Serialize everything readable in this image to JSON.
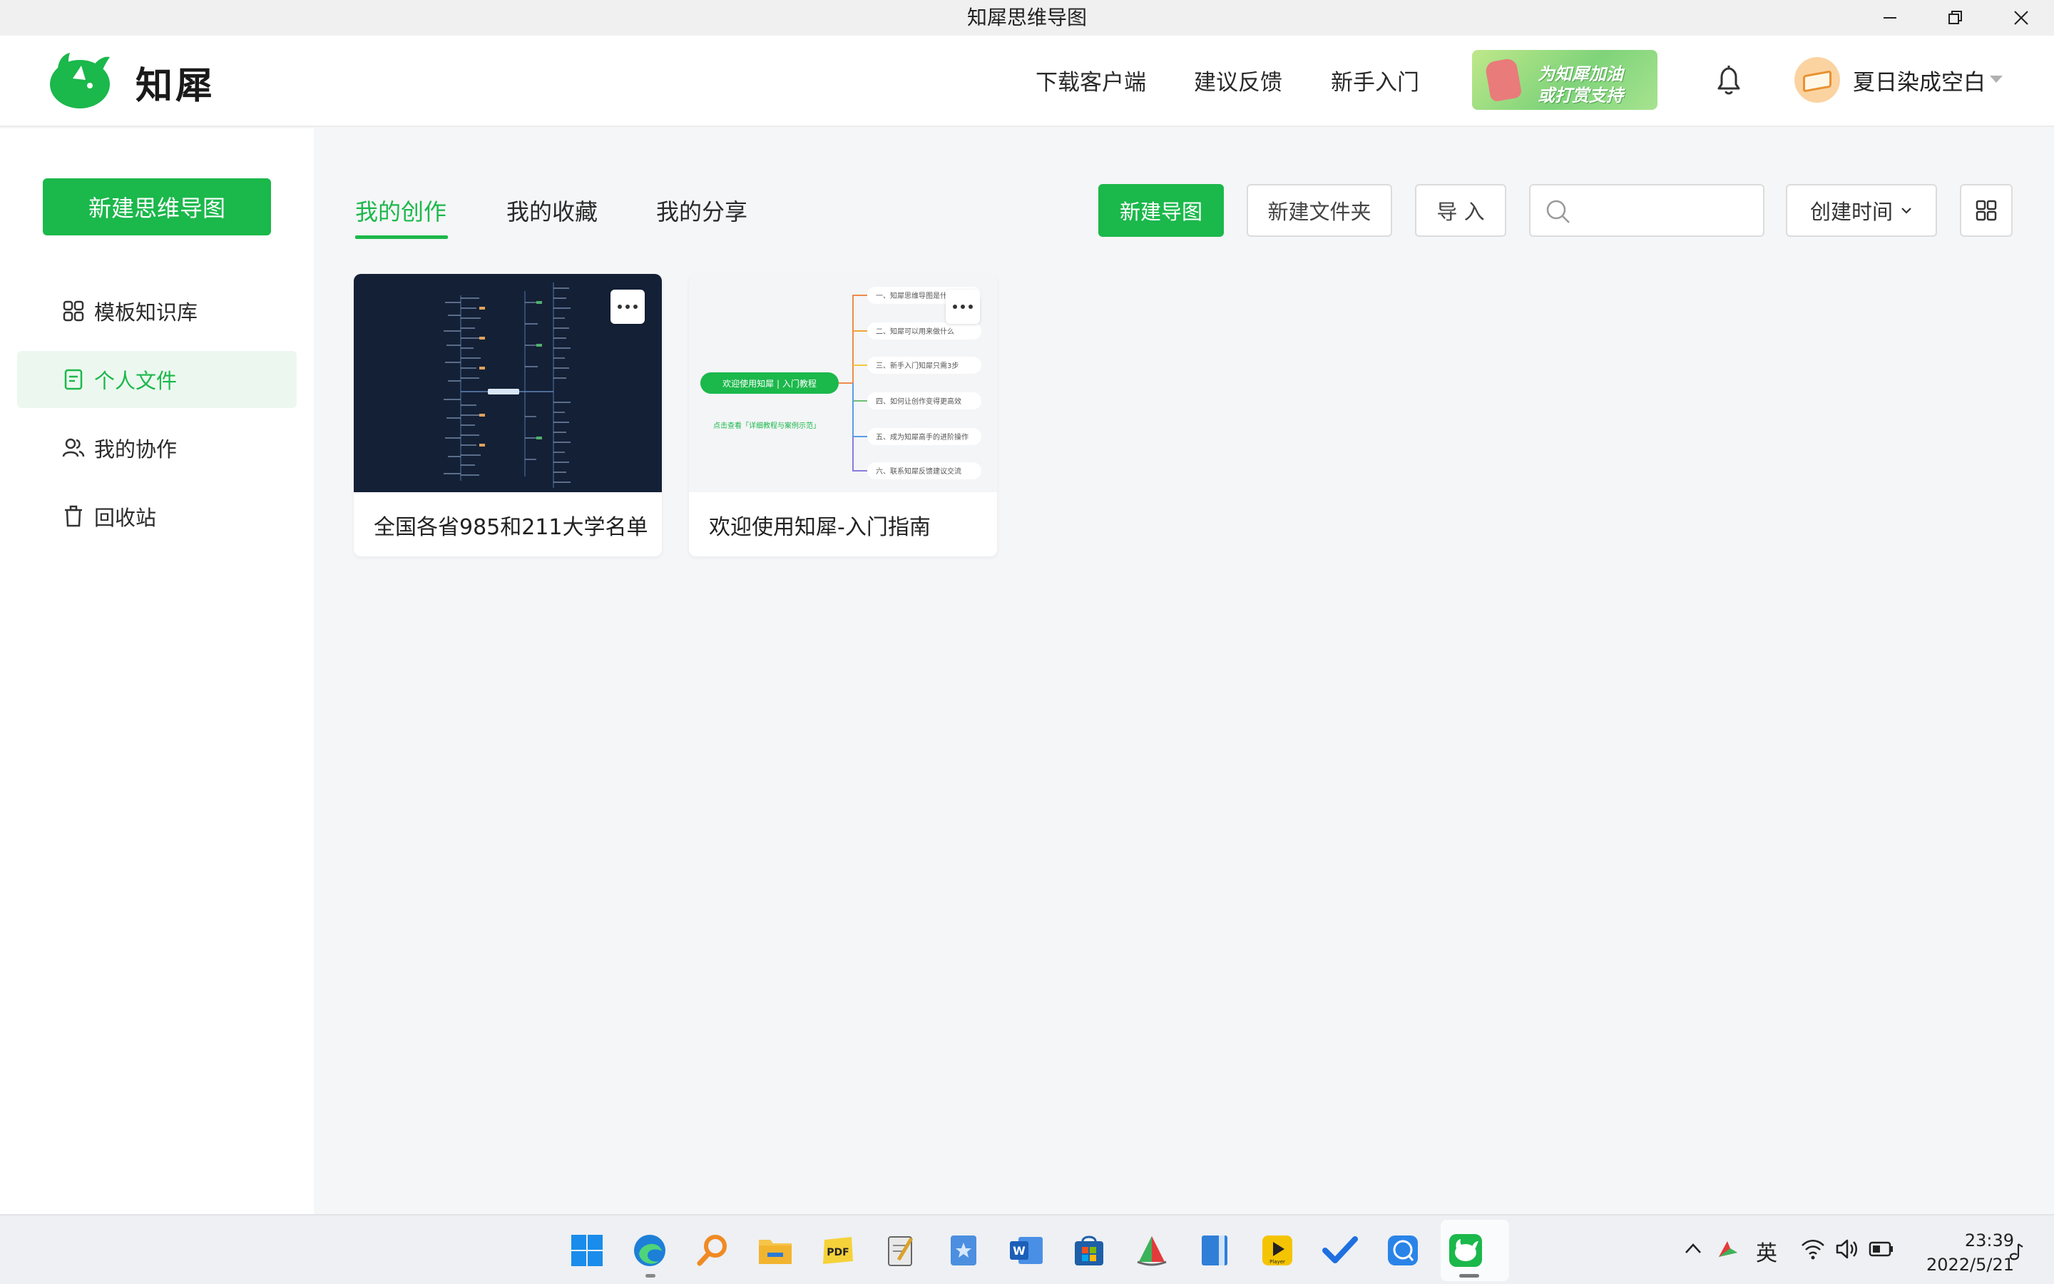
{
  "window": {
    "title": "知犀思维导图"
  },
  "header": {
    "brand": "知犀",
    "nav": [
      "下载客户端",
      "建议反馈",
      "新手入门"
    ],
    "promo": {
      "line1": "为知犀加油",
      "line2": "或打赏支持"
    },
    "user_name": "夏日染成空白"
  },
  "sidebar": {
    "new_button": "新建思维导图",
    "items": [
      {
        "label": "模板知识库",
        "icon": "template-grid-icon"
      },
      {
        "label": "个人文件",
        "icon": "document-icon",
        "active": true
      },
      {
        "label": "我的协作",
        "icon": "users-icon"
      },
      {
        "label": "回收站",
        "icon": "trash-icon"
      }
    ]
  },
  "main": {
    "tabs": [
      "我的创作",
      "我的收藏",
      "我的分享"
    ],
    "active_tab": "我的创作",
    "toolbar": {
      "new_map": "新建导图",
      "new_folder": "新建文件夹",
      "import": "导 入",
      "search_placeholder": "",
      "sort_label": "创建时间"
    },
    "files": [
      {
        "name": "全国各省985和211大学名单",
        "theme": "dark"
      },
      {
        "name": "欢迎使用知犀-入门指南",
        "theme": "light",
        "root": "欢迎使用知犀 | 入门教程",
        "link": "点击查看「详细教程与案例示范」",
        "branches": [
          "一、知犀思维导图是什",
          "二、知犀可以用来做什么",
          "三、新手入门知犀只需3步",
          "四、如何让创作变得更高效",
          "五、成为知犀高手的进阶操作",
          "六、联系知犀反馈建议交流"
        ]
      }
    ]
  },
  "taskbar": {
    "tray": {
      "ime": "英"
    },
    "clock": {
      "time": "23:39",
      "date": "2022/5/21"
    }
  },
  "colors": {
    "accent": "#1bb84b",
    "dark_card": "#142036"
  }
}
